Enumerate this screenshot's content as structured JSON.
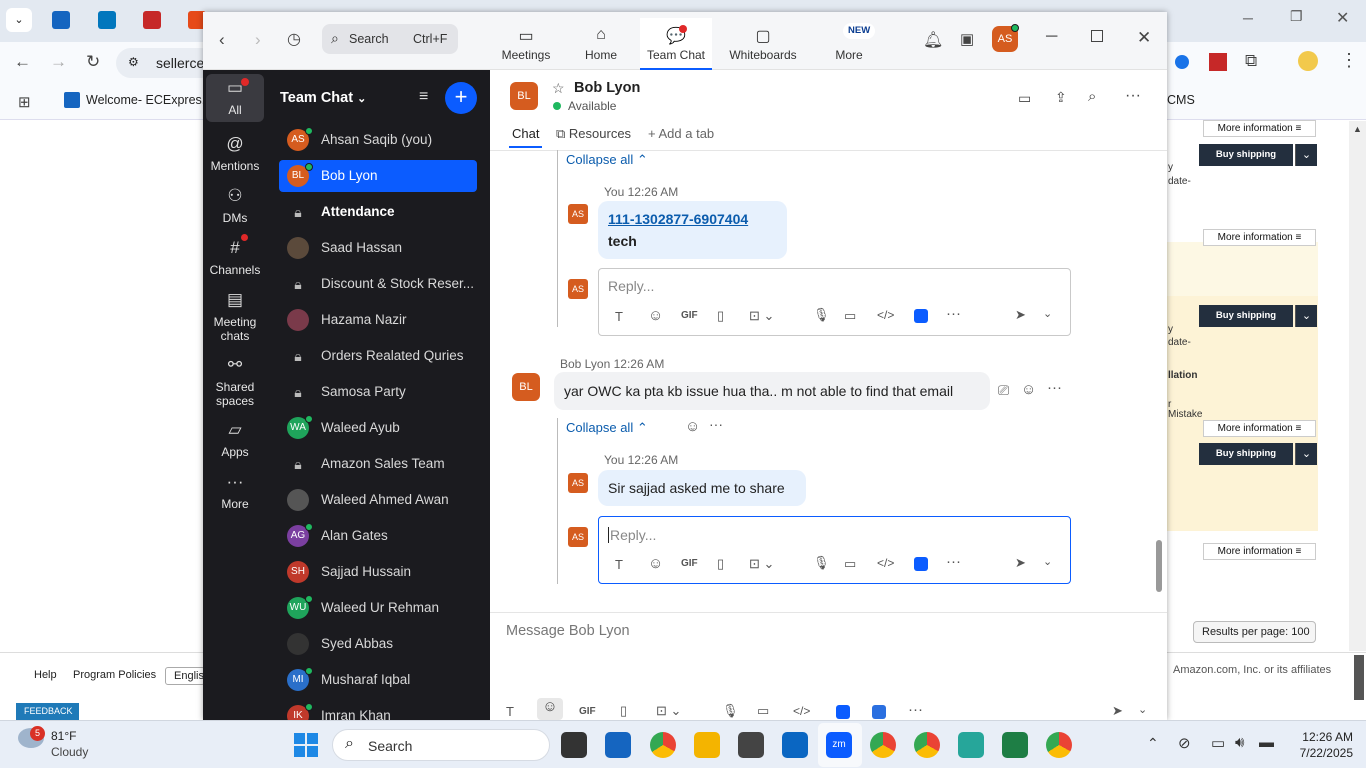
{
  "browser": {
    "address": "sellerce",
    "bookmark_welcome": "Welcome- ECExpres...",
    "bookmark_cms": "CMS",
    "footer_help": "Help",
    "footer_policies": "Program Policies",
    "footer_lang": "English",
    "footer_copyright": "Amazon.com, Inc. or its affiliates",
    "feedback": "FEEDBACK",
    "results_per_page": "Results per page: 100"
  },
  "amazon": {
    "more_info": "More information",
    "buy_shipping": "Buy shipping",
    "frag1": "y",
    "frag2": "date-",
    "frag3": "llation",
    "frag4": "r",
    "frag5": "Mistake"
  },
  "zoom": {
    "search_placeholder": "Search",
    "search_shortcut": "Ctrl+F",
    "nav": {
      "meetings": "Meetings",
      "home": "Home",
      "team_chat": "Team Chat",
      "whiteboards": "Whiteboards",
      "more": "More",
      "new_badge": "NEW"
    },
    "user_initials": "AS",
    "rail": {
      "all": "All",
      "mentions": "Mentions",
      "dms": "DMs",
      "channels": "Channels",
      "meeting_chats": "Meeting chats",
      "shared_spaces": "Shared spaces",
      "apps": "Apps",
      "more": "More"
    },
    "list_title": "Team Chat",
    "channels": [
      {
        "initials": "AS",
        "label": "Ahsan Saqib (you)",
        "color": "#d55c1f"
      },
      {
        "initials": "BL",
        "label": "Bob Lyon",
        "color": "#d55c1f"
      },
      {
        "initials": "",
        "label": "Attendance",
        "color": ""
      },
      {
        "initials": "",
        "label": "Saad Hassan",
        "color": "#5b4a3b"
      },
      {
        "initials": "",
        "label": "Discount & Stock Reser...",
        "color": ""
      },
      {
        "initials": "",
        "label": "Hazama Nazir",
        "color": "#7a3a4a"
      },
      {
        "initials": "",
        "label": "Orders Realated Quries",
        "color": ""
      },
      {
        "initials": "",
        "label": "Samosa Party",
        "color": ""
      },
      {
        "initials": "WA",
        "label": "Waleed Ayub",
        "color": "#1fa45b"
      },
      {
        "initials": "",
        "label": "Amazon Sales Team",
        "color": ""
      },
      {
        "initials": "",
        "label": "Waleed Ahmed Awan",
        "color": "#555"
      },
      {
        "initials": "AG",
        "label": "Alan Gates",
        "color": "#7b3fa0"
      },
      {
        "initials": "SH",
        "label": "Sajjad Hussain",
        "color": "#c0392b"
      },
      {
        "initials": "WU",
        "label": "Waleed Ur Rehman",
        "color": "#1fa45b"
      },
      {
        "initials": "",
        "label": "Syed Abbas",
        "color": "#333"
      },
      {
        "initials": "MI",
        "label": "Musharaf Iqbal",
        "color": "#2a6fc9"
      },
      {
        "initials": "IK",
        "label": "Imran Khan",
        "color": "#c0392b"
      }
    ],
    "chat": {
      "contact_initials": "BL",
      "contact_name": "Bob Lyon",
      "status": "Available",
      "tabs": {
        "chat": "Chat",
        "resources": "Resources",
        "add_tab": "Add a tab"
      },
      "collapse_all": "Collapse all",
      "reply1": {
        "sender": "You",
        "time": "12:26 AM",
        "link": "111-1302877-6907404",
        "text": "tech"
      },
      "reply_placeholder": "Reply...",
      "msg2": {
        "sender": "Bob Lyon",
        "time": "12:26 AM",
        "text": "yar OWC ka pta kb issue hua tha.. m not able to find that email"
      },
      "reply2": {
        "sender": "You",
        "time": "12:26 AM",
        "text": "Sir sajjad asked me to share"
      },
      "composer_placeholder": "Message Bob Lyon",
      "gif": "GIF"
    }
  },
  "taskbar": {
    "temp": "81°F",
    "weather": "Cloudy",
    "weather_badge": "5",
    "search": "Search",
    "time": "12:26 AM",
    "date": "7/22/2025"
  }
}
